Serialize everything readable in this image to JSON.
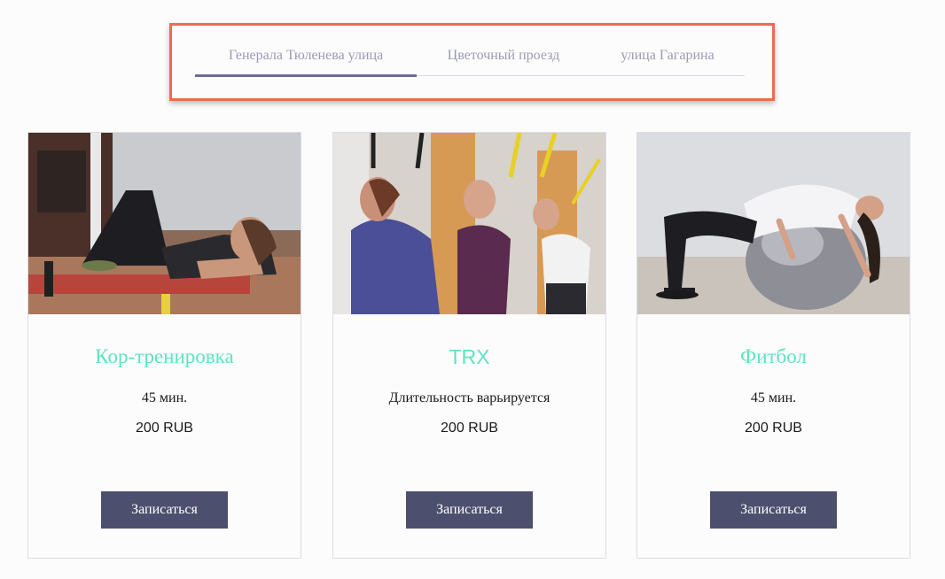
{
  "tabs": [
    {
      "label": "Генерала Тюленева улица",
      "active": true
    },
    {
      "label": "Цветочный проезд",
      "active": false
    },
    {
      "label": "улица Гагарина",
      "active": false
    }
  ],
  "colors": {
    "accent_frame": "#ee6a55",
    "active_tab_underline": "#6a6b9e",
    "card_title": "#5ee3c1",
    "button_bg": "#4d4f6e"
  },
  "cards": [
    {
      "image_icon": "core-workout-photo",
      "title": "Кор-тренировка",
      "duration": "45 мин.",
      "price": "200 RUB",
      "button_label": "Записаться"
    },
    {
      "image_icon": "trx-workout-photo",
      "title": "TRX",
      "duration": "Длительность варьируется",
      "price": "200 RUB",
      "button_label": "Записаться"
    },
    {
      "image_icon": "fitball-workout-photo",
      "title": "Фитбол",
      "duration": "45 мин.",
      "price": "200 RUB",
      "button_label": "Записаться"
    }
  ]
}
